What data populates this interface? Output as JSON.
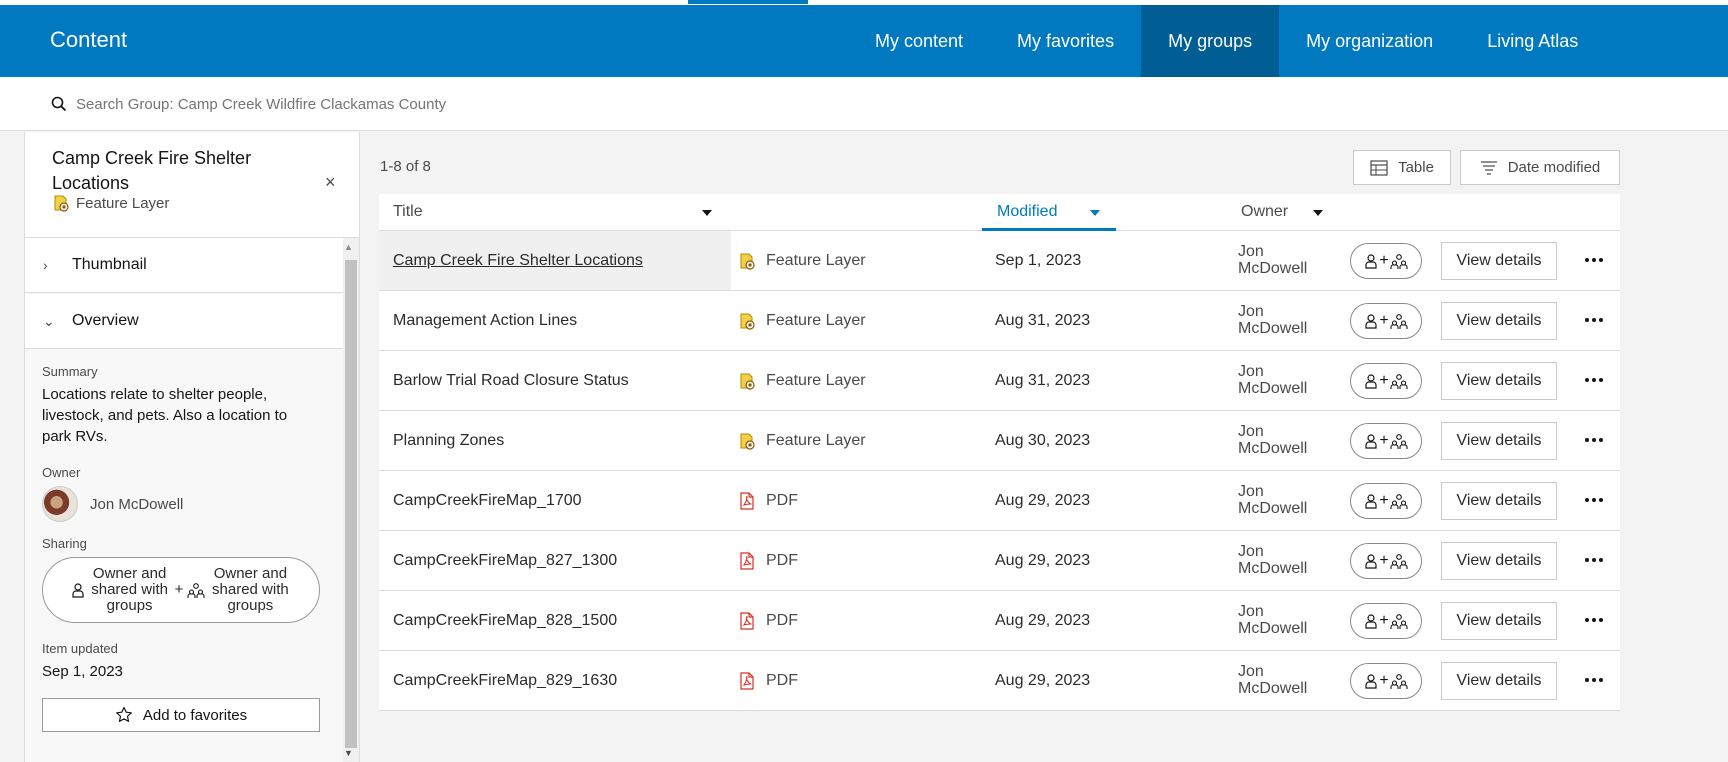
{
  "app": {
    "title": "Content",
    "nav": [
      {
        "label": "My content",
        "active": false
      },
      {
        "label": "My favorites",
        "active": false
      },
      {
        "label": "My groups",
        "active": true
      },
      {
        "label": "My organization",
        "active": false
      },
      {
        "label": "Living Atlas",
        "active": false
      }
    ],
    "accent_color": "#0079c1",
    "active_nav_color": "#005e95"
  },
  "search": {
    "placeholder": "Search Group: Camp Creek Wildfire Clackamas County",
    "icon": "search-icon"
  },
  "sidebar": {
    "item_name": "Camp Creek Fire Shelter Locations",
    "item_type": "Feature Layer",
    "close_icon": "×",
    "sections": {
      "thumbnail": "Thumbnail",
      "overview": "Overview"
    },
    "summary_label": "Summary",
    "summary": "Locations relate to shelter people, livestock, and pets. Also a location to park RVs.",
    "owner_label": "Owner",
    "owner": "Jon McDowell",
    "sharing_label": "Sharing",
    "sharing_left": "Owner and shared with groups",
    "sharing_plus": "+",
    "sharing_right": "Owner and shared with groups",
    "updated_label": "Item updated",
    "updated": "Sep 1, 2023",
    "favorites_label": "Add to favorites"
  },
  "results": {
    "count": "1-8 of 8",
    "view_label": "Table",
    "sort_label": "Date modified"
  },
  "table": {
    "columns": {
      "title": "Title",
      "modified": "Modified",
      "owner": "Owner"
    },
    "view_details": "View details",
    "rows": [
      {
        "title": "Camp Creek Fire Shelter Locations",
        "type": "Feature Layer",
        "kind": "feature",
        "modified": "Sep 1, 2023",
        "owner_first": "Jon",
        "owner_last": "McDowell",
        "selected": true
      },
      {
        "title": "Management Action Lines",
        "type": "Feature Layer",
        "kind": "feature",
        "modified": "Aug 31, 2023",
        "owner_first": "Jon",
        "owner_last": "McDowell",
        "selected": false
      },
      {
        "title": "Barlow Trial Road Closure Status",
        "type": "Feature Layer",
        "kind": "feature",
        "modified": "Aug 31, 2023",
        "owner_first": "Jon",
        "owner_last": "McDowell",
        "selected": false
      },
      {
        "title": "Planning Zones",
        "type": "Feature Layer",
        "kind": "feature",
        "modified": "Aug 30, 2023",
        "owner_first": "Jon",
        "owner_last": "McDowell",
        "selected": false
      },
      {
        "title": "CampCreekFireMap_1700",
        "type": "PDF",
        "kind": "pdf",
        "modified": "Aug 29, 2023",
        "owner_first": "Jon",
        "owner_last": "McDowell",
        "selected": false
      },
      {
        "title": "CampCreekFireMap_827_1300",
        "type": "PDF",
        "kind": "pdf",
        "modified": "Aug 29, 2023",
        "owner_first": "Jon",
        "owner_last": "McDowell",
        "selected": false
      },
      {
        "title": "CampCreekFireMap_828_1500",
        "type": "PDF",
        "kind": "pdf",
        "modified": "Aug 29, 2023",
        "owner_first": "Jon",
        "owner_last": "McDowell",
        "selected": false
      },
      {
        "title": "CampCreekFireMap_829_1630",
        "type": "PDF",
        "kind": "pdf",
        "modified": "Aug 29, 2023",
        "owner_first": "Jon",
        "owner_last": "McDowell",
        "selected": false
      }
    ]
  }
}
